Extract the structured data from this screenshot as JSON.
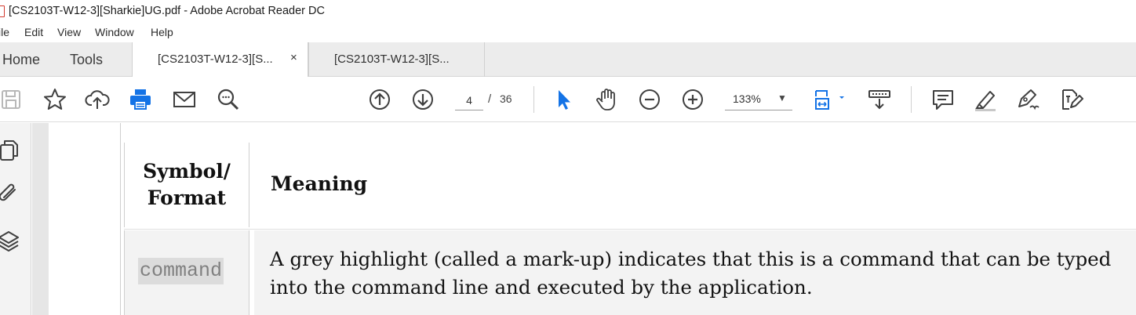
{
  "window": {
    "title": "[CS2103T-W12-3][Sharkie]UG.pdf - Adobe Acrobat Reader DC"
  },
  "menu": [
    "ile",
    "Edit",
    "View",
    "Window",
    "Help"
  ],
  "tabs": {
    "home": "Home",
    "tools": "Tools",
    "documents": [
      {
        "label": "[CS2103T-W12-3][S...",
        "active": true,
        "close": "×"
      },
      {
        "label": "[CS2103T-W12-3][S...",
        "active": false
      }
    ]
  },
  "toolbar": {
    "icons": [
      "save-icon",
      "star-icon",
      "cloud-upload-icon",
      "print-icon",
      "email-icon",
      "search-icon",
      "page-up-icon",
      "page-down-icon",
      "select-cursor-icon",
      "hand-icon",
      "zoom-out-icon",
      "zoom-in-icon",
      "fit-page-icon",
      "scroll-mode-icon",
      "comment-icon",
      "highlight-icon",
      "fill-sign-icon",
      "edit-pdf-icon"
    ],
    "page_current": "4",
    "page_separator": "/",
    "page_total": "36",
    "zoom": "133%",
    "accent_color": "#1473e6",
    "print_color": "#1473e6"
  },
  "left_rail": {
    "icons": [
      "pages-icon",
      "attachment-icon",
      "layers-icon"
    ]
  },
  "document": {
    "table": {
      "header_symbol": "Symbol/ Format",
      "header_symbol_line1": "Symbol/",
      "header_symbol_line2": "Format",
      "header_meaning": "Meaning",
      "rows": [
        {
          "symbol": "command",
          "meaning": "A grey highlight (called a mark-up) indicates that this is a command that can be typed into the command line and executed by the application."
        }
      ]
    }
  }
}
